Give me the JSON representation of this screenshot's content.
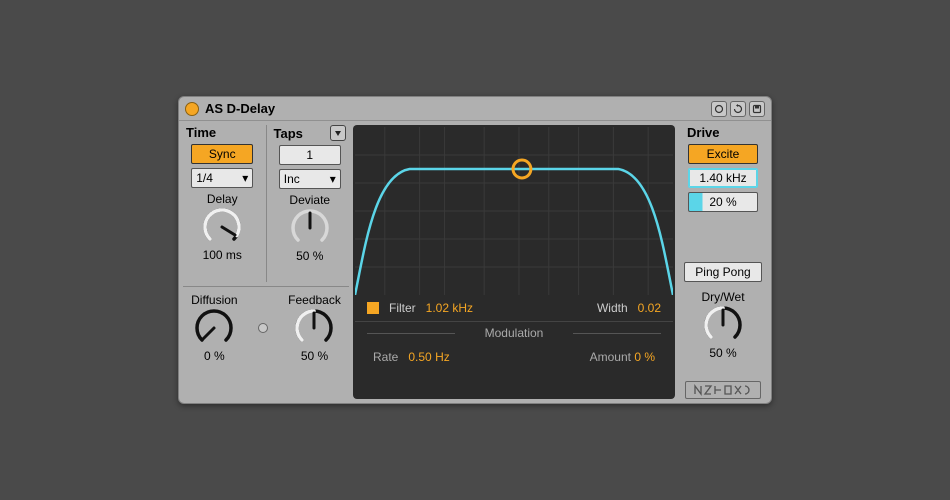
{
  "title": "AS D-Delay",
  "time": {
    "label": "Time",
    "sync_btn": "Sync",
    "tempo_division": "1/4",
    "delay_label": "Delay",
    "delay_value": "100 ms",
    "delay_angle": 100
  },
  "taps": {
    "label": "Taps",
    "count": "1",
    "mode_select": "Inc",
    "deviate_label": "Deviate",
    "deviate_value": "50 %",
    "deviate_angle": 0
  },
  "diffusion": {
    "label": "Diffusion",
    "value": "0 %",
    "angle": -135
  },
  "feedback": {
    "label": "Feedback",
    "value": "50 %",
    "angle": 0
  },
  "filter": {
    "label": "Filter",
    "freq": "1.02 kHz",
    "width_label": "Width",
    "width_value": "0.02"
  },
  "modulation": {
    "header": "Modulation",
    "rate_label": "Rate",
    "rate_value": "0.50 Hz",
    "amount_label": "Amount",
    "amount_value": "0 %"
  },
  "drive": {
    "label": "Drive",
    "mode_btn": "Excite",
    "freq": "1.40 kHz",
    "amount": "20 %"
  },
  "pingpong": {
    "label": "Ping Pong"
  },
  "drywet": {
    "label": "Dry/Wet",
    "value": "50 %",
    "angle": 0
  },
  "colors": {
    "accent": "#f5a623",
    "curve": "#5bd5e8"
  }
}
